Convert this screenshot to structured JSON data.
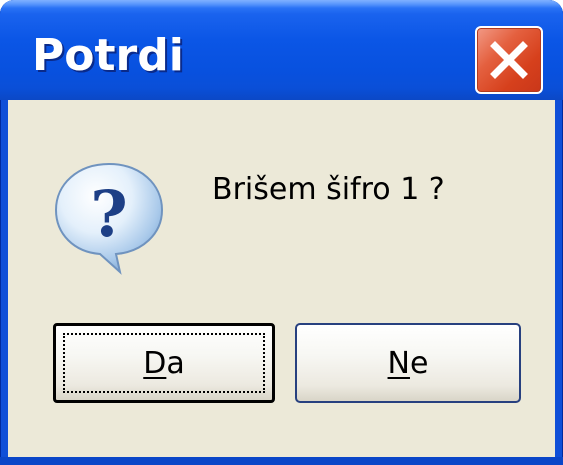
{
  "window": {
    "title": "Potrdi",
    "close_icon": "close-icon",
    "colors": {
      "titlebar": "#0b56e6",
      "client_bg": "#ece9d8",
      "close_button": "#d6401c"
    }
  },
  "dialog": {
    "icon": "question-icon",
    "message": "Brišem šifro 1 ?"
  },
  "buttons": {
    "yes": {
      "mnemonic": "D",
      "rest": "a",
      "label": "Da",
      "default": true
    },
    "no": {
      "mnemonic": "N",
      "rest": "e",
      "label": "Ne",
      "default": false
    }
  }
}
